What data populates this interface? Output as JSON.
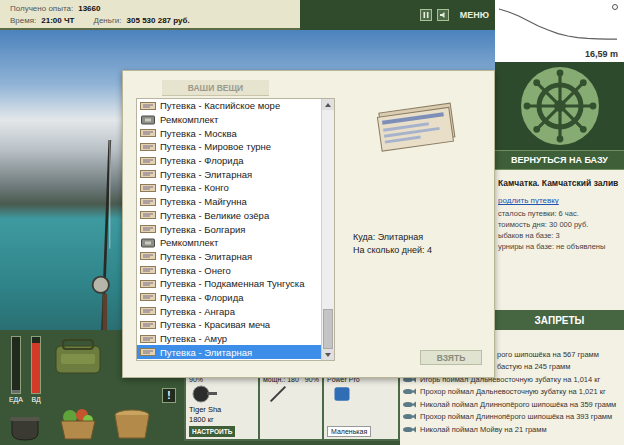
{
  "status": {
    "exp_label": "Получено опыта:",
    "exp": "13660",
    "time_label": "Время:",
    "time": "21:00 ЧТ",
    "money_label": "Деньги:",
    "money": "305 530 287 руб."
  },
  "top_menu": {
    "label": "МЕНЮ"
  },
  "depth_chart": {
    "values": [
      1.5,
      3,
      5,
      7.5,
      10,
      12,
      13.8,
      15,
      15.8,
      16.2,
      16.45,
      16.59,
      16.59
    ],
    "reading": "16,59 m"
  },
  "return_button": "ВЕРНУТЬСЯ НА БАЗУ",
  "location": {
    "title": "Камчатка. Камчатский залив",
    "extend_link": "родлить путевку",
    "lines": [
      "сталось путевки: 6 час.",
      "тоимость дня: 30 000 руб.",
      "ыбаков на базе: 3",
      "урниры на базе: не объявлены"
    ]
  },
  "bans_header": "ЗАПРЕТЫ",
  "catch_log": [
    {
      "text": "рого шипошёка на 567 грамм",
      "kind": "cut"
    },
    {
      "text": "бастую на 245 грамм",
      "kind": "cut"
    },
    {
      "text": "Игорь поймал Дальневосточную зубатку на 1,014 кг",
      "kind": "full"
    },
    {
      "text": "Прохор поймал Дальневосточную зубатку на 1,021 кг",
      "kind": "full"
    },
    {
      "text": "Николай поймал Длиннопёрого шипошёка на 359 грамм",
      "kind": "full"
    },
    {
      "text": "Прохор поймал Длиннопёрого шипошёка на 393 грамм",
      "kind": "full"
    },
    {
      "text": "Николай поймал Мойву на 21 грамм",
      "kind": "full"
    }
  ],
  "toolbar": {
    "gauges": [
      {
        "label": "ЕДА",
        "level": 0.05,
        "color": "#6b6b6b"
      },
      {
        "label": "ВД",
        "level": 0.9,
        "color": "#d23a2a"
      }
    ],
    "alert": "!",
    "rod": {
      "wear": "90%",
      "line_name": "Tiger Sha",
      "line_strength": "1800 кг",
      "setup_button": "НАСТРОИТЬ",
      "power": "мощн.: 180",
      "power_wear": "90%",
      "reel": "Power Pro",
      "hook": "Маленькая"
    }
  },
  "modal": {
    "header": "ВАШИ ВЕЩИ",
    "items": [
      {
        "label": "Путевка - Каспийское море",
        "kind": "ticket",
        "selected": false
      },
      {
        "label": "Ремкомплект",
        "kind": "repair",
        "selected": false
      },
      {
        "label": "Путевка - Москва",
        "kind": "ticket",
        "selected": false
      },
      {
        "label": "Путевка - Мировое турне",
        "kind": "ticket",
        "selected": false
      },
      {
        "label": "Путевка - Флорида",
        "kind": "ticket",
        "selected": false
      },
      {
        "label": "Путевка - Элитарная",
        "kind": "ticket",
        "selected": false
      },
      {
        "label": "Путевка - Конго",
        "kind": "ticket",
        "selected": false
      },
      {
        "label": "Путевка - Майгунна",
        "kind": "ticket",
        "selected": false
      },
      {
        "label": "Путевка - Великие озёра",
        "kind": "ticket",
        "selected": false
      },
      {
        "label": "Путевка - Болгария",
        "kind": "ticket",
        "selected": false
      },
      {
        "label": "Ремкомплект",
        "kind": "repair",
        "selected": false
      },
      {
        "label": "Путевка - Элитарная",
        "kind": "ticket",
        "selected": false
      },
      {
        "label": "Путевка - Онего",
        "kind": "ticket",
        "selected": false
      },
      {
        "label": "Путевка - Подкаменная Тунгуска",
        "kind": "ticket",
        "selected": false
      },
      {
        "label": "Путевка - Флорида",
        "kind": "ticket",
        "selected": false
      },
      {
        "label": "Путевка - Ангара",
        "kind": "ticket",
        "selected": false
      },
      {
        "label": "Путевка - Красивая меча",
        "kind": "ticket",
        "selected": false
      },
      {
        "label": "Путевка - Амур",
        "kind": "ticket",
        "selected": false
      },
      {
        "label": "Путевка - Элитарная",
        "kind": "ticket",
        "selected": true
      }
    ],
    "list_scroll": {
      "level": 1
    },
    "detail": {
      "to": "Куда: Элитарная",
      "days": "На сколько дней: 4"
    },
    "take_button": "ВЗЯТЬ"
  }
}
